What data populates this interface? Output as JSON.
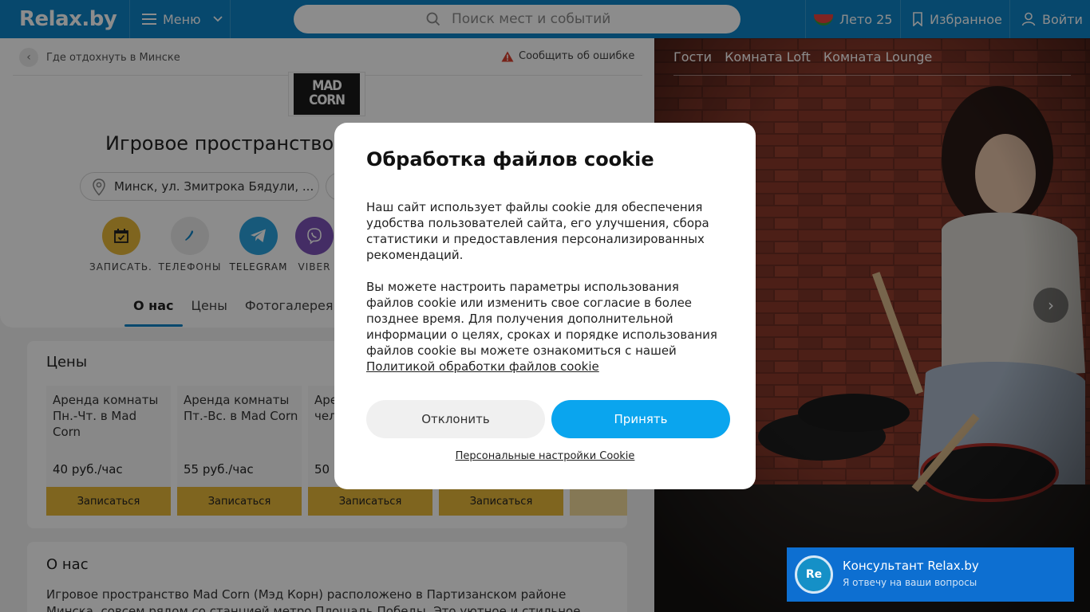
{
  "header": {
    "logo": "Relax.by",
    "menu_label": "Меню",
    "search_placeholder": "Поиск мест и событий",
    "summer_label": "Лето 25",
    "favorites_label": "Избранное",
    "login_label": "Войти"
  },
  "breadcrumb": {
    "back_text": "Где отдохнуть в Минске",
    "report_text": "Сообщить об ошибке"
  },
  "venue": {
    "logo_line1": "MAD",
    "logo_line2": "CORN",
    "title": "Игровое пространство Mad Corn",
    "address": "Минск, ул. Змитрока Бядули, ..."
  },
  "actions": [
    {
      "label": "ЗАПИСАТЬ...",
      "icon": "calendar-icon",
      "color": "#e8b83a"
    },
    {
      "label": "ТЕЛЕФОНЫ",
      "icon": "phone-icon",
      "color": "#ececec"
    },
    {
      "label": "TELEGRAM",
      "icon": "telegram-icon",
      "color": "#2aa3de"
    },
    {
      "label": "VIBER",
      "icon": "viber-icon",
      "color": "#7c52b8"
    }
  ],
  "tabs": [
    "О нас",
    "Цены",
    "Фотогалерея"
  ],
  "prices": {
    "title": "Цены",
    "items": [
      {
        "name": "Аренда комнаты Пн.-Чт. в Mad Corn",
        "price": "40 руб./час",
        "button": "Записаться"
      },
      {
        "name": "Аренда комнаты Пт.-Вс. в Mad Corn",
        "price": "55 руб./час",
        "button": "Записаться"
      },
      {
        "name": "Аре... Пн.-... Cor... чел...",
        "price": "50",
        "button": "Записаться"
      },
      {
        "name": "",
        "price": "",
        "button": "Записаться"
      }
    ]
  },
  "about": {
    "title": "О нас",
    "text": "Игровое пространство Mad Corn (Мэд Корн) расположено в Партизанском районе Минска, совсем рядом со станцией метро Площадь Победы. Это уютное и стильное"
  },
  "gallery": {
    "tabs": [
      "Гости",
      "Комната Loft",
      "Комната Lounge"
    ]
  },
  "cookie": {
    "title": "Обработка файлов cookie",
    "para1": "Наш сайт использует файлы cookie для обеспечения удобства пользователей сайта, его улучшения, сбора статистики и предоставления персонализированных рекомендаций.",
    "para2": "Вы можете настроить параметры использования файлов cookie или изменить свое согласие в более позднее время. Для получения дополнительной информации о целях, сроках и порядке использования файлов cookie вы можете ознакомиться с нашей",
    "policy_link": "Политикой обработки файлов cookie",
    "decline": "Отклонить",
    "accept": "Принять",
    "settings_link": "Персональные настройки Cookie"
  },
  "chat": {
    "avatar": "Re",
    "title": "Консультант Relax.by",
    "subtitle": "Я отвечу на ваши вопросы"
  },
  "colors": {
    "brand": "#0d84c6",
    "accent_button": "#0aa5ee",
    "price_button": "#e8b83a"
  }
}
